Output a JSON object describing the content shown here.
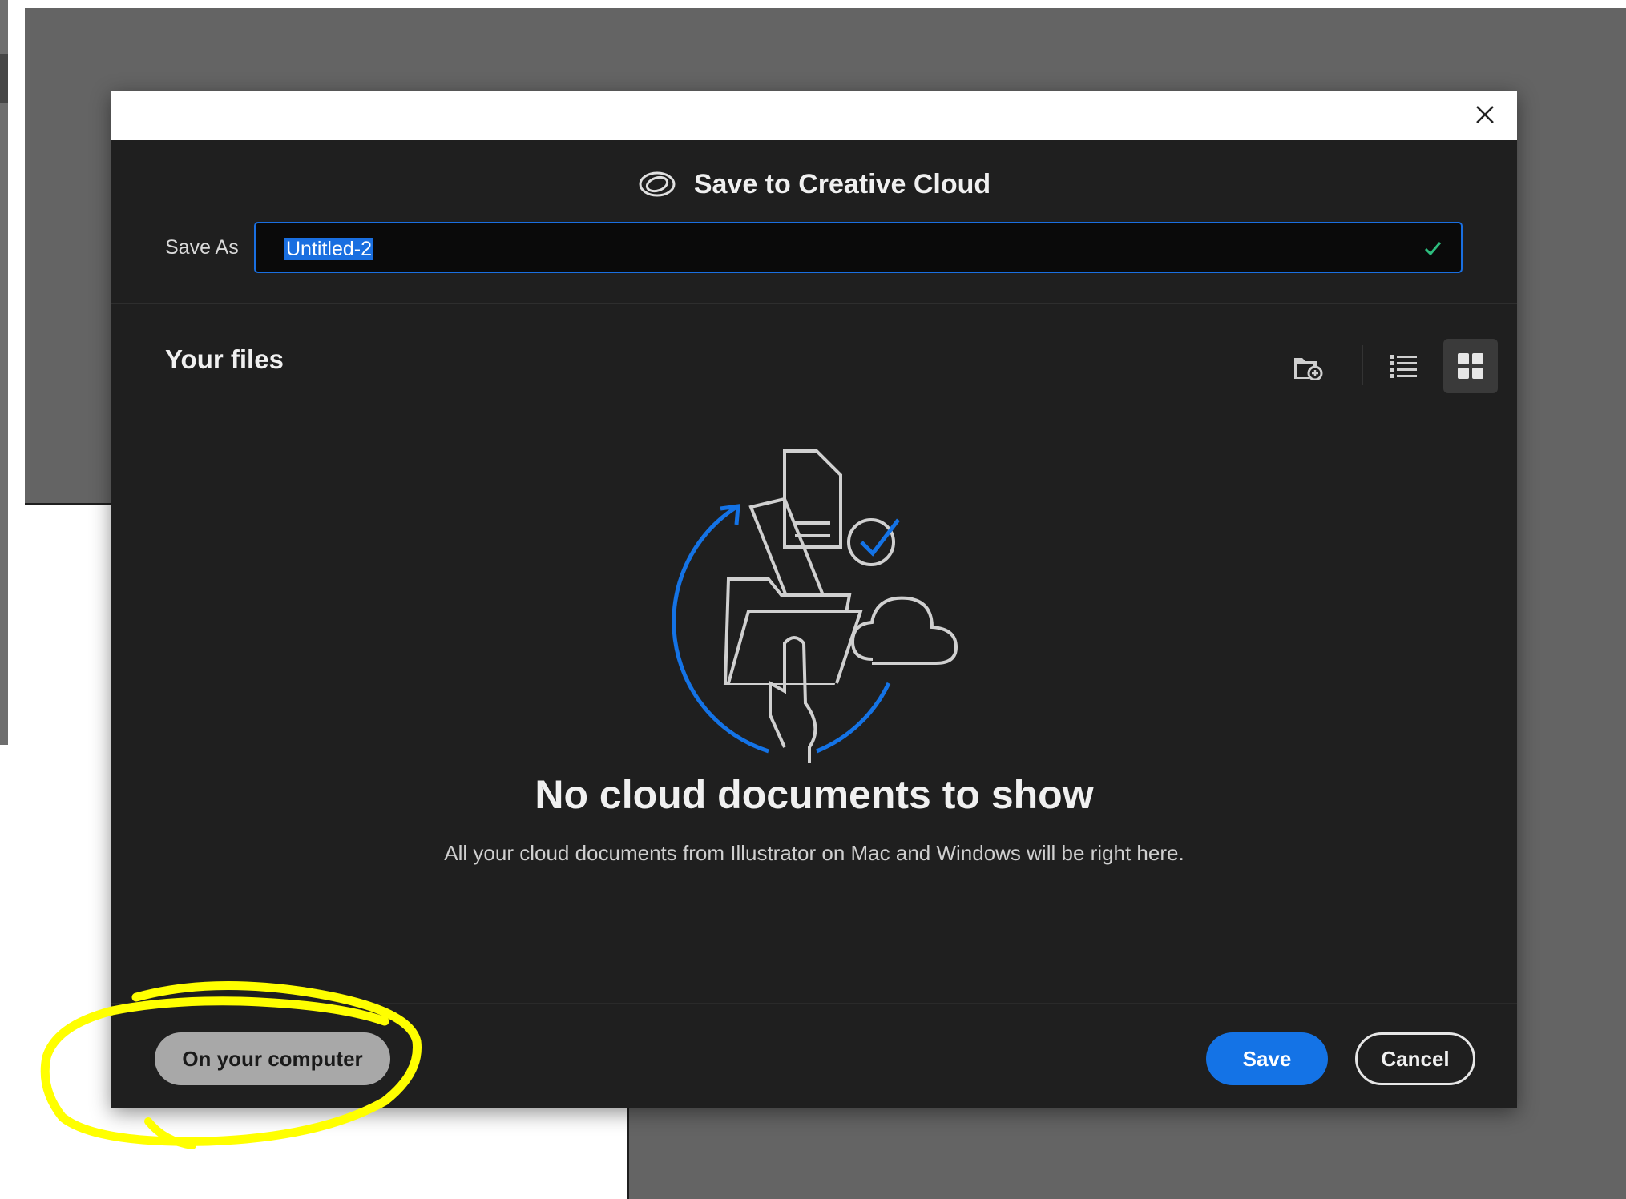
{
  "dialog": {
    "title": "Save to Creative Cloud",
    "close_icon": "close-icon",
    "save_as": {
      "label": "Save As",
      "value": "Untitled-2"
    },
    "files_section": {
      "heading": "Your files",
      "toolbar": [
        "new-folder-icon",
        "list-view-icon",
        "grid-view-icon"
      ],
      "selected_view": "grid"
    },
    "empty_state": {
      "title": "No cloud documents to show",
      "description": "All your cloud documents from Illustrator on Mac and Windows will be right here."
    },
    "footer": {
      "on_computer_label": "On your computer",
      "save_label": "Save",
      "cancel_label": "Cancel"
    }
  },
  "colors": {
    "accent": "#1473e6",
    "dialog_bg": "#1f1f1f",
    "annotation": "#ffff00"
  }
}
